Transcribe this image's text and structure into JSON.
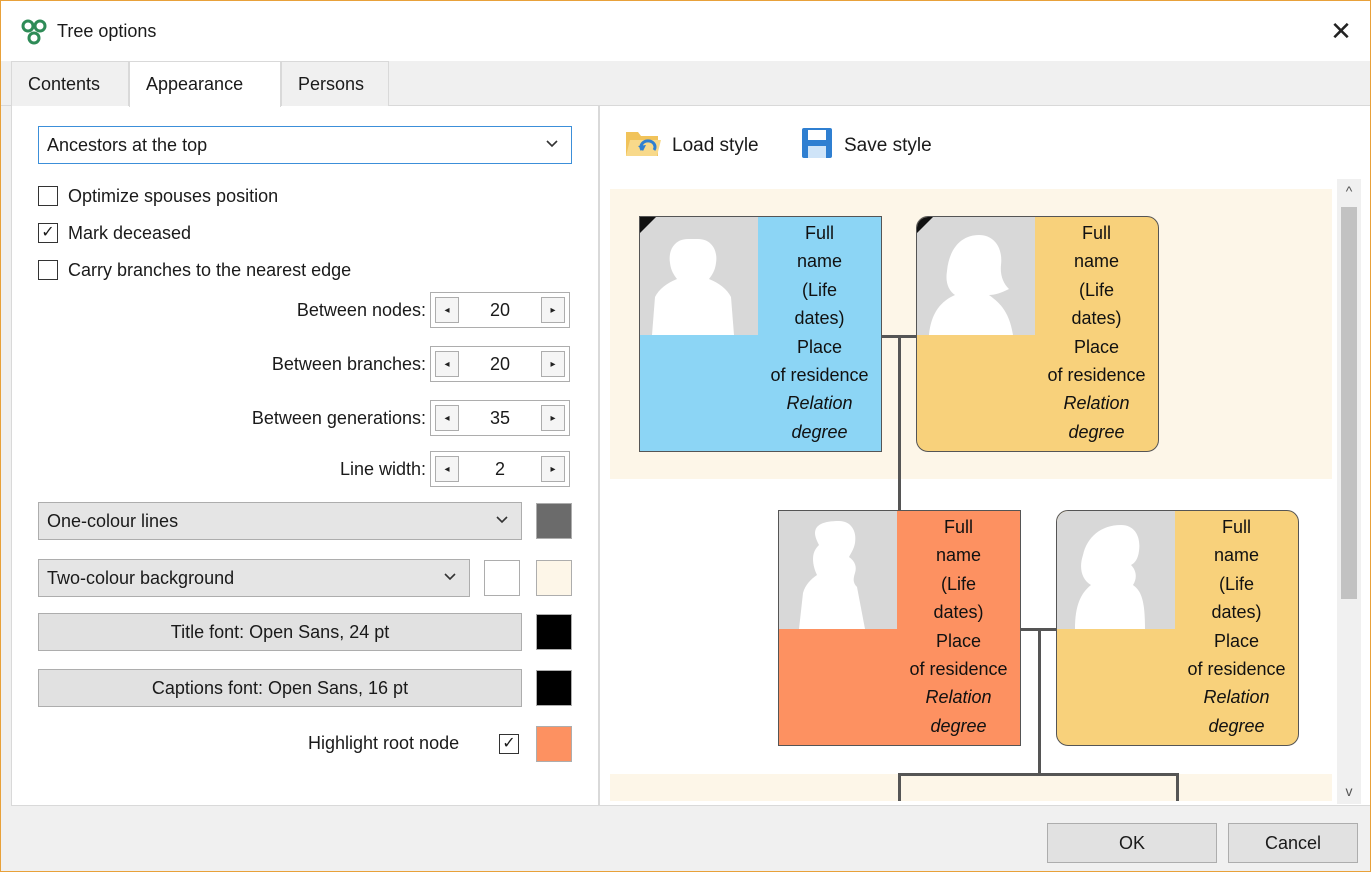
{
  "window": {
    "title": "Tree options",
    "app_icon": "app-tree-icon",
    "close_glyph": "✕"
  },
  "tabs": [
    {
      "label": "Contents",
      "active": false
    },
    {
      "label": "Appearance",
      "active": true
    },
    {
      "label": "Persons",
      "active": false
    }
  ],
  "layout_select": {
    "value": "Ancestors at the top",
    "icon": "chevron-down-icon"
  },
  "checkboxes": [
    {
      "label": "Optimize spouses position",
      "checked": false
    },
    {
      "label": "Mark deceased",
      "checked": true,
      "glyph": "✓"
    },
    {
      "label": "Carry branches to the nearest edge",
      "checked": false
    }
  ],
  "spacing": [
    {
      "label": "Between nodes:",
      "value": "20"
    },
    {
      "label": "Between branches:",
      "value": "20"
    },
    {
      "label": "Between generations:",
      "value": "35"
    },
    {
      "label": "Line width:",
      "value": "2"
    }
  ],
  "spin_glyphs": {
    "decrement": "◂",
    "increment": "▸"
  },
  "lines_select": {
    "value": "One-colour lines",
    "color": "#6b6b6b"
  },
  "background_select": {
    "value": "Two-colour background",
    "colors": [
      "#ffffff",
      "#fdf6e8"
    ]
  },
  "title_font": {
    "label": "Title font: Open Sans, 24 pt",
    "color": "#000000"
  },
  "captions_font": {
    "label": "Captions font: Open Sans, 16 pt",
    "color": "#000000"
  },
  "highlight_root": {
    "label": "Highlight root node",
    "checked": true,
    "glyph": "✓",
    "color": "#fd9161"
  },
  "toolbar": {
    "load_style": "Load style",
    "save_style": "Save style",
    "load_icon": "folder-open-icon",
    "save_icon": "floppy-disk-icon"
  },
  "node_caption": {
    "line1": "Full",
    "line2": "name",
    "line3": "(Life",
    "line4": "dates)",
    "line5": "Place",
    "line6": "of residence",
    "line7": "Relation",
    "line8": "degree"
  },
  "nodes": [
    {
      "id": "grandfather",
      "color": "#8cd5f5",
      "deceased": true,
      "gender": "male"
    },
    {
      "id": "grandmother",
      "color": "#f8d17b",
      "deceased": true,
      "gender": "female"
    },
    {
      "id": "root",
      "color": "#fd9161",
      "deceased": false,
      "gender": "male"
    },
    {
      "id": "spouse",
      "color": "#f8d17b",
      "deceased": false,
      "gender": "female"
    }
  ],
  "scrollbar": {
    "up_glyph": "^",
    "down_glyph": "v"
  },
  "footer": {
    "ok": "OK",
    "cancel": "Cancel"
  }
}
